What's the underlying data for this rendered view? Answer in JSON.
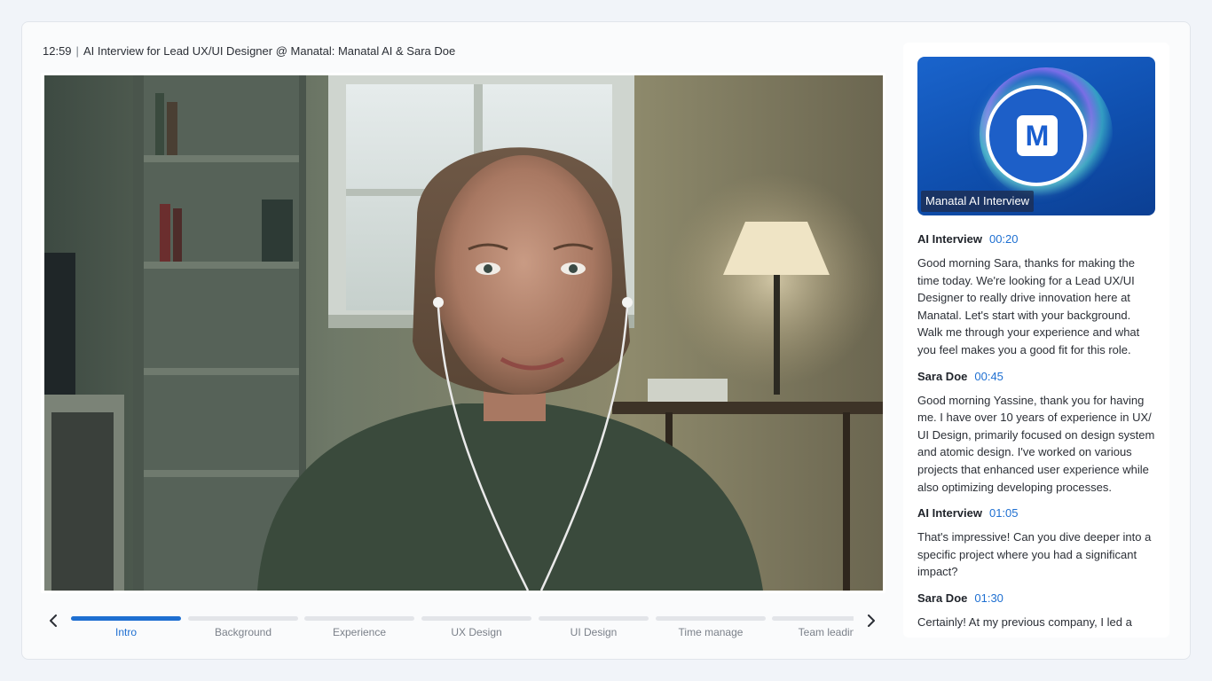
{
  "header": {
    "time": "12:59",
    "separator": "|",
    "title": "AI Interview for Lead UX/UI Designer @ Manatal: Manatal AI & Sara Doe"
  },
  "video": {
    "icon": "candidate-video-feed"
  },
  "timeline": {
    "prev_icon": "chevron-left-icon",
    "next_icon": "chevron-right-icon",
    "active_index": 0,
    "segments": [
      {
        "label": "Intro"
      },
      {
        "label": "Background"
      },
      {
        "label": "Experience"
      },
      {
        "label": "UX Design"
      },
      {
        "label": "UI Design"
      },
      {
        "label": "Time manage"
      },
      {
        "label": "Team leadin"
      }
    ]
  },
  "ai_card": {
    "logo_letter": "M",
    "tag": "Manatal AI Interview"
  },
  "transcript": [
    {
      "speaker": "AI Interview",
      "time": "00:20",
      "text": "Good morning Sara, thanks for making the time today. We're looking for a Lead UX/UI Designer to really drive innovation here at Manatal. Let's start with your background. Walk me through your experience and what you feel makes you a good fit for this role."
    },
    {
      "speaker": "Sara Doe",
      "time": "00:45",
      "text": "Good morning Yassine, thank you for having me. I have over 10 years of experience in UX/ UI Design, primarily focused on design system and atomic design. I've worked on various projects that enhanced user experience while also optimizing developing processes."
    },
    {
      "speaker": "AI Interview",
      "time": "01:05",
      "text": "That's impressive! Can you dive deeper into a specific project where you had a significant impact?"
    },
    {
      "speaker": "Sara Doe",
      "time": "01:30",
      "text": "Certainly! At my previous company, I led a"
    }
  ],
  "colors": {
    "accent": "#1e6fd1",
    "track": "#e3e5e9"
  }
}
